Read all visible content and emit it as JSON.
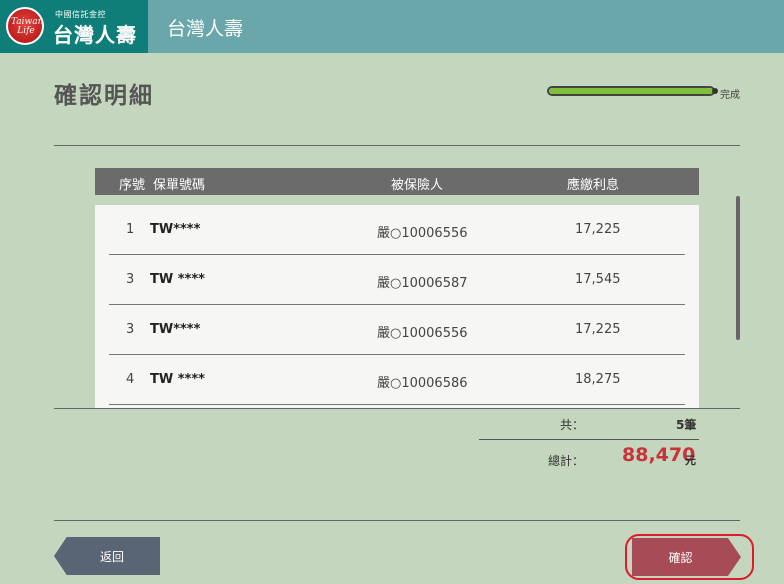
{
  "header": {
    "logo_subtitle": "中國信託金控",
    "logo_brand": "台灣人壽",
    "logo_script": "Taiwan Life",
    "title": "台灣人壽"
  },
  "page": {
    "title": "確認明細",
    "progress_label": "完成",
    "progress": 1.0
  },
  "table": {
    "columns": {
      "seq": "序號",
      "policy": "保單號碼",
      "insured": "被保險人",
      "interest": "應繳利息"
    },
    "rows": [
      {
        "seq": "1",
        "policy": "TW****",
        "insured": "嚴○10006556",
        "interest": "17,225"
      },
      {
        "seq": "3",
        "policy": "TW ****",
        "insured": "嚴○10006587",
        "interest": "17,545"
      },
      {
        "seq": "3",
        "policy": "TW****",
        "insured": "嚴○10006556",
        "interest": "17,225"
      },
      {
        "seq": "4",
        "policy": "TW ****",
        "insured": "嚴○10006586",
        "interest": "18,275"
      }
    ]
  },
  "totals": {
    "count_label": "共：",
    "count_value": "5筆",
    "total_label": "總計：",
    "total_value": "88,470",
    "total_unit": "元"
  },
  "buttons": {
    "back": "返回",
    "confirm": "確認"
  },
  "colors": {
    "background": "#c4d6bd",
    "header": "#6aa7ab",
    "logo_block": "#0f7d78",
    "total_accent": "#c8323a",
    "highlight": "#e0192b"
  }
}
